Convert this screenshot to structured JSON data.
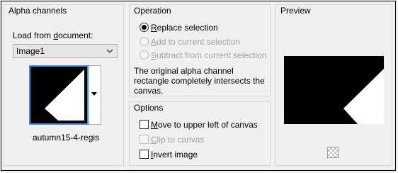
{
  "alpha_channels": {
    "title": "Alpha channels",
    "load_label_pre": "Load from ",
    "load_label_key": "d",
    "load_label_post": "ocument:",
    "selected_document": "Image1",
    "channel_name": "autumn15-4-regis"
  },
  "operation": {
    "title": "Operation",
    "options": [
      {
        "key": "R",
        "rest": "eplace selection",
        "checked": true,
        "disabled": false
      },
      {
        "key": "A",
        "rest": "dd to current selection",
        "checked": false,
        "disabled": true
      },
      {
        "key": "S",
        "rest": "ubtract from current selection",
        "checked": false,
        "disabled": true
      }
    ],
    "message": "The original alpha channel rectangle completely intersects the canvas."
  },
  "options": {
    "title": "Options",
    "move": {
      "key": "M",
      "rest": "ove to upper left of canvas",
      "checked": false,
      "disabled": false
    },
    "clip": {
      "key": "C",
      "rest": "lip to canvas",
      "checked": false,
      "disabled": true
    },
    "invert": {
      "key": "I",
      "rest": "nvert image",
      "checked": false,
      "disabled": false
    }
  },
  "preview": {
    "title": "Preview"
  },
  "colors": {
    "thumb_border": "#3d8ee8",
    "disabled_text": "#a0a0a0"
  }
}
